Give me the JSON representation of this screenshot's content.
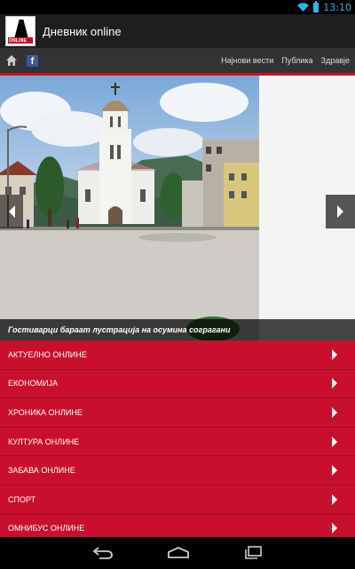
{
  "status": {
    "time": "13:10"
  },
  "app": {
    "title": "Дневник online",
    "logo_text": "ONLINE"
  },
  "nav": {
    "links": [
      "Најнови вести",
      "Публика",
      "Здравје"
    ]
  },
  "slider": {
    "caption": "Гостиварци бараат лустрација на осумина согрaгани"
  },
  "menu": {
    "items": [
      "АКТУЕЛНО ОНЛИНЕ",
      "ЕКОНОМИЈА",
      "ХРОНИКА ОНЛИНЕ",
      "КУЛТУРА ОНЛИНЕ",
      "ЗАБАВА ОНЛИНЕ",
      "СПОРТ",
      "ОМНИБУС ОНЛИНЕ"
    ]
  },
  "colors": {
    "accent": "#c8102e",
    "clock": "#33b5e5",
    "actionbar": "#1e1e1e",
    "navbar": "#333333"
  },
  "icons": [
    "wifi-icon",
    "battery-icon",
    "home-icon",
    "facebook-icon",
    "chevron-left-icon",
    "chevron-right-icon",
    "back-icon",
    "home-nav-icon",
    "recents-icon"
  ]
}
